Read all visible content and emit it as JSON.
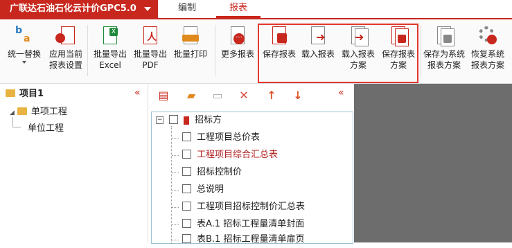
{
  "app": {
    "title": "广联达石油石化云计价GPC5.0"
  },
  "tabs": [
    {
      "label": "编制"
    },
    {
      "label": "报表"
    }
  ],
  "ribbon": {
    "replace": "统一替换",
    "apply_settings": "应用当前\n报表设置",
    "export_excel": "批量导出\nExcel",
    "export_pdf": "批量导出\nPDF",
    "batch_print": "批量打印",
    "more_reports": "更多报表",
    "save_report": "保存报表",
    "load_report": "载入报表",
    "load_scheme": "载入报表\n方案",
    "save_scheme": "保存报表\n方案",
    "save_system_scheme": "保存为系统\n报表方案",
    "restore_system_scheme": "恢复系统\n报表方案"
  },
  "tree": {
    "project": "项目1",
    "unit_project": "单项工程",
    "sub_unit": "单位工程"
  },
  "report_list": {
    "root": "招标方",
    "items": [
      {
        "label": "工程项目总价表",
        "highlight": false
      },
      {
        "label": "工程项目综合汇总表",
        "highlight": true
      },
      {
        "label": "招标控制价",
        "highlight": false
      },
      {
        "label": "总说明",
        "highlight": false
      },
      {
        "label": "工程项目招标控制价汇总表",
        "highlight": false
      },
      {
        "label": "表A.1 招标工程量清单封面",
        "highlight": false
      },
      {
        "label": "表B.1 招标工程量清单扉页",
        "highlight": false
      }
    ]
  },
  "colors": {
    "accent": "#c8271e",
    "highlight_text": "#b11f1f"
  }
}
